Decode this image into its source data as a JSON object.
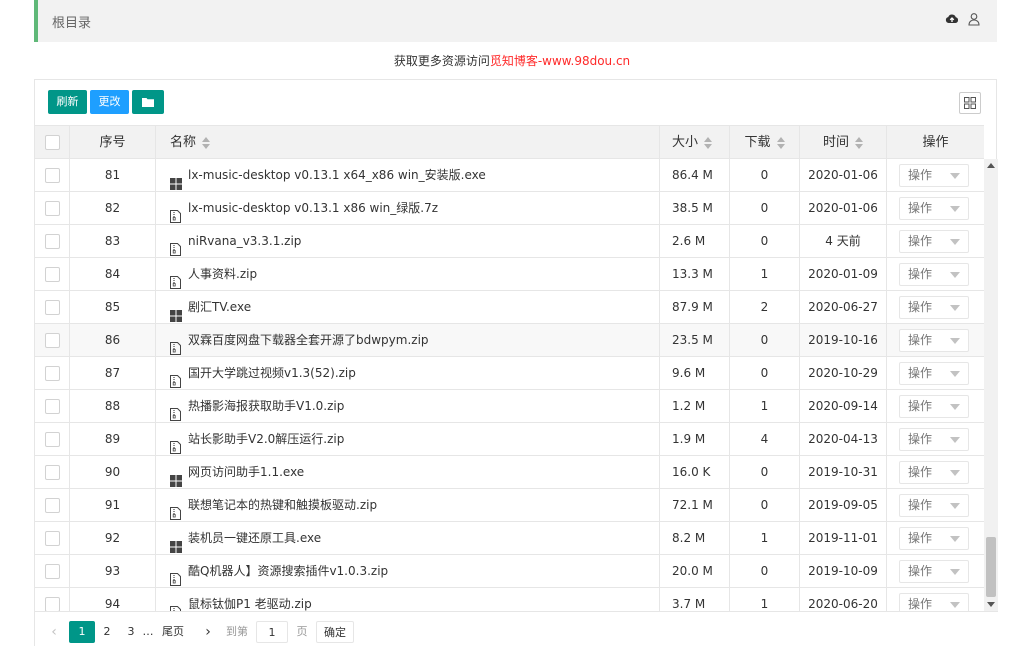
{
  "breadcrumb": {
    "label": "根目录"
  },
  "topbar_icons": [
    "cloud-upload-icon",
    "user-icon"
  ],
  "notice": {
    "prefix": "获取更多资源访问",
    "link": "觅知博客-www.98dou.cn"
  },
  "toolbar": {
    "refresh_label": "刷新",
    "change_label": "更改",
    "folder_icon": "folder-icon",
    "grid_icon": "grid-view-icon"
  },
  "columns": {
    "index": "序号",
    "name": "名称",
    "size": "大小",
    "downloads": "下载",
    "time": "时间",
    "action": "操作"
  },
  "rows": [
    {
      "index": "81",
      "icon": "windows-icon",
      "name": "lx-music-desktop v0.13.1 x64_x86 win_安装版.exe",
      "size": "86.4 M",
      "downloads": "0",
      "time": "2020-01-06",
      "action": "操作"
    },
    {
      "index": "82",
      "icon": "zip-file-icon",
      "name": "lx-music-desktop v0.13.1 x86 win_绿版.7z",
      "size": "38.5 M",
      "downloads": "0",
      "time": "2020-01-06",
      "action": "操作"
    },
    {
      "index": "83",
      "icon": "zip-file-icon",
      "name": "niRvana_v3.3.1.zip",
      "size": "2.6 M",
      "downloads": "0",
      "time": "4 天前",
      "action": "操作"
    },
    {
      "index": "84",
      "icon": "zip-file-icon",
      "name": "人事资料.zip",
      "size": "13.3 M",
      "downloads": "1",
      "time": "2020-01-09",
      "action": "操作"
    },
    {
      "index": "85",
      "icon": "windows-icon",
      "name": "剧汇TV.exe",
      "size": "87.9 M",
      "downloads": "2",
      "time": "2020-06-27",
      "action": "操作"
    },
    {
      "index": "86",
      "icon": "zip-file-icon",
      "name": "双霖百度网盘下载器全套开源了bdwpym.zip",
      "size": "23.5 M",
      "downloads": "0",
      "time": "2019-10-16",
      "action": "操作"
    },
    {
      "index": "87",
      "icon": "zip-file-icon",
      "name": "国开大学跳过视频v1.3(52).zip",
      "size": "9.6 M",
      "downloads": "0",
      "time": "2020-10-29",
      "action": "操作"
    },
    {
      "index": "88",
      "icon": "zip-file-icon",
      "name": "热播影海报获取助手V1.0.zip",
      "size": "1.2 M",
      "downloads": "1",
      "time": "2020-09-14",
      "action": "操作"
    },
    {
      "index": "89",
      "icon": "zip-file-icon",
      "name": "站长影助手V2.0解压运行.zip",
      "size": "1.9 M",
      "downloads": "4",
      "time": "2020-04-13",
      "action": "操作"
    },
    {
      "index": "90",
      "icon": "windows-icon",
      "name": "网页访问助手1.1.exe",
      "size": "16.0 K",
      "downloads": "0",
      "time": "2019-10-31",
      "action": "操作"
    },
    {
      "index": "91",
      "icon": "zip-file-icon",
      "name": "联想笔记本的热键和触摸板驱动.zip",
      "size": "72.1 M",
      "downloads": "0",
      "time": "2019-09-05",
      "action": "操作"
    },
    {
      "index": "92",
      "icon": "windows-icon",
      "name": "装机员一键还原工具.exe",
      "size": "8.2 M",
      "downloads": "1",
      "time": "2019-11-01",
      "action": "操作"
    },
    {
      "index": "93",
      "icon": "zip-file-icon",
      "name": "酷Q机器人】资源搜索插件v1.0.3.zip",
      "size": "20.0 M",
      "downloads": "0",
      "time": "2019-10-09",
      "action": "操作"
    },
    {
      "index": "94",
      "icon": "zip-file-icon",
      "name": "鼠标钛伽P1 老驱动.zip",
      "size": "3.7 M",
      "downloads": "1",
      "time": "2020-06-20",
      "action": "操作"
    }
  ],
  "pagination": {
    "prev": "‹",
    "pages": [
      "1",
      "2",
      "3"
    ],
    "current": "1",
    "ellipsis": "…",
    "last": "尾页",
    "next": "›",
    "goto_label": "到第",
    "goto_value": "1",
    "page_suffix": "页",
    "confirm": "确定"
  },
  "colors": {
    "accent_green": "#009688",
    "accent_blue": "#1e9fff",
    "breadcrumb_bar": "#5fb878",
    "link_red": "#ff2a2a"
  }
}
